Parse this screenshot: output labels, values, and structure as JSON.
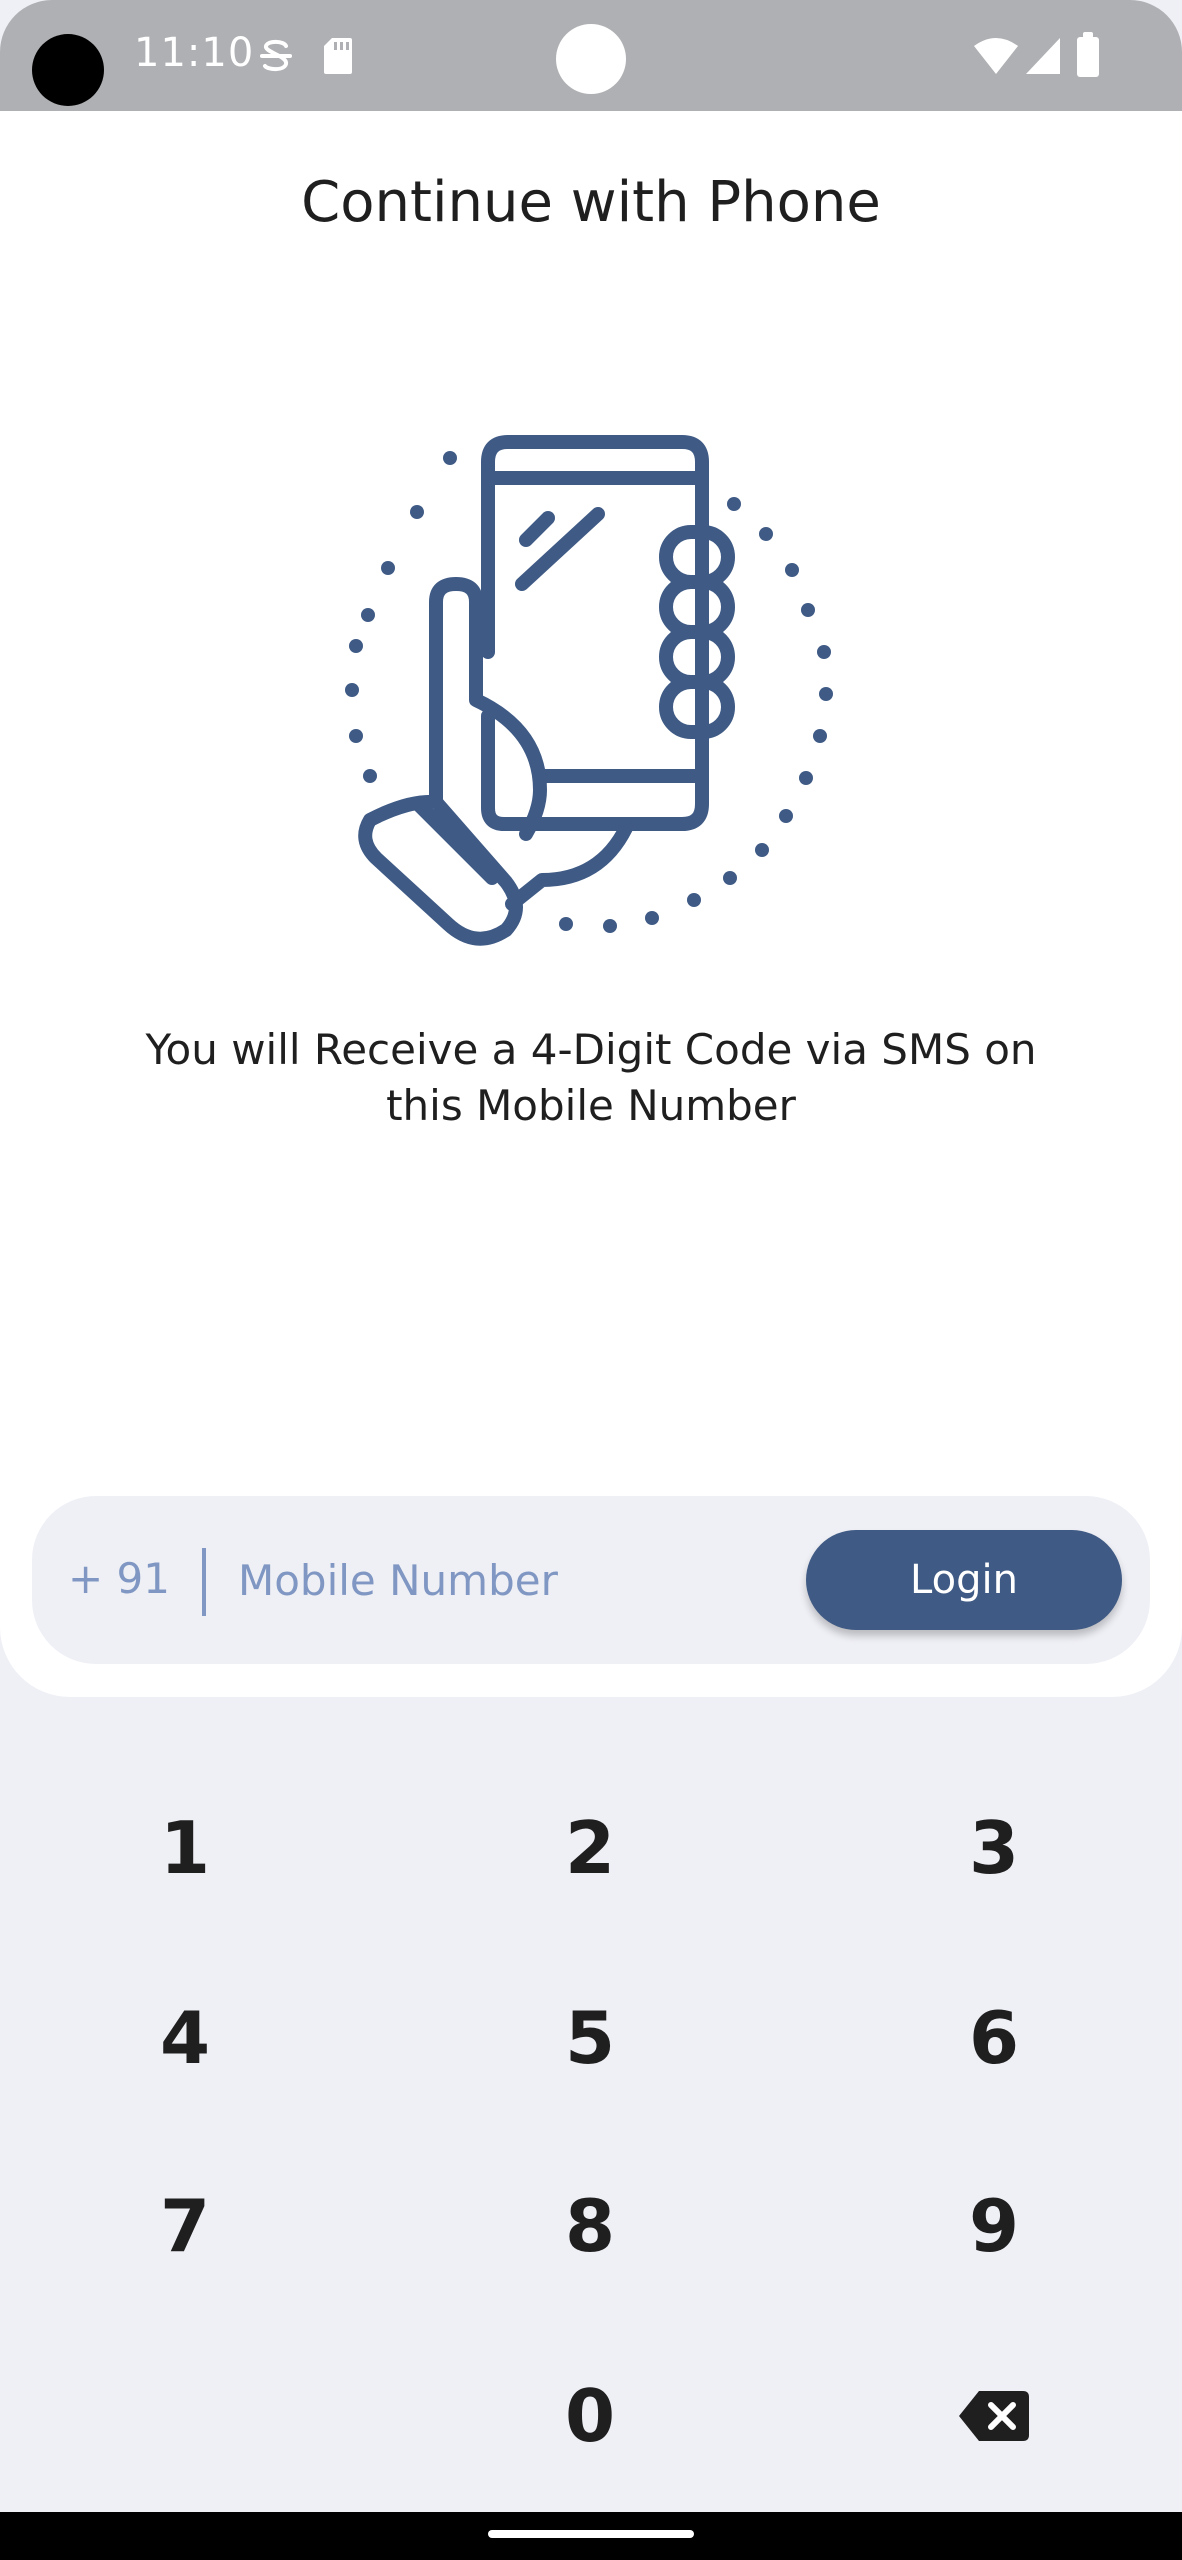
{
  "status_bar": {
    "time": "11:10"
  },
  "header": {
    "title": "Continue with Phone"
  },
  "info": {
    "line1": "You will Receive a 4-Digit Code via SMS on",
    "line2": "this Mobile Number"
  },
  "phone_form": {
    "country_code": "+ 91",
    "mobile_placeholder": "Mobile Number",
    "mobile_value": "",
    "login_label": "Login"
  },
  "keypad": {
    "keys": [
      "1",
      "2",
      "3",
      "4",
      "5",
      "6",
      "7",
      "8",
      "9",
      "0"
    ]
  },
  "colors": {
    "accent": "#3f5a84",
    "placeholder": "#7f97c2",
    "panel_background": "#eff0f6",
    "status_bar": "#afb0b3"
  },
  "icons": {
    "phone_illustration": "hand-holding-phone-icon",
    "backspace": "backspace-icon"
  }
}
